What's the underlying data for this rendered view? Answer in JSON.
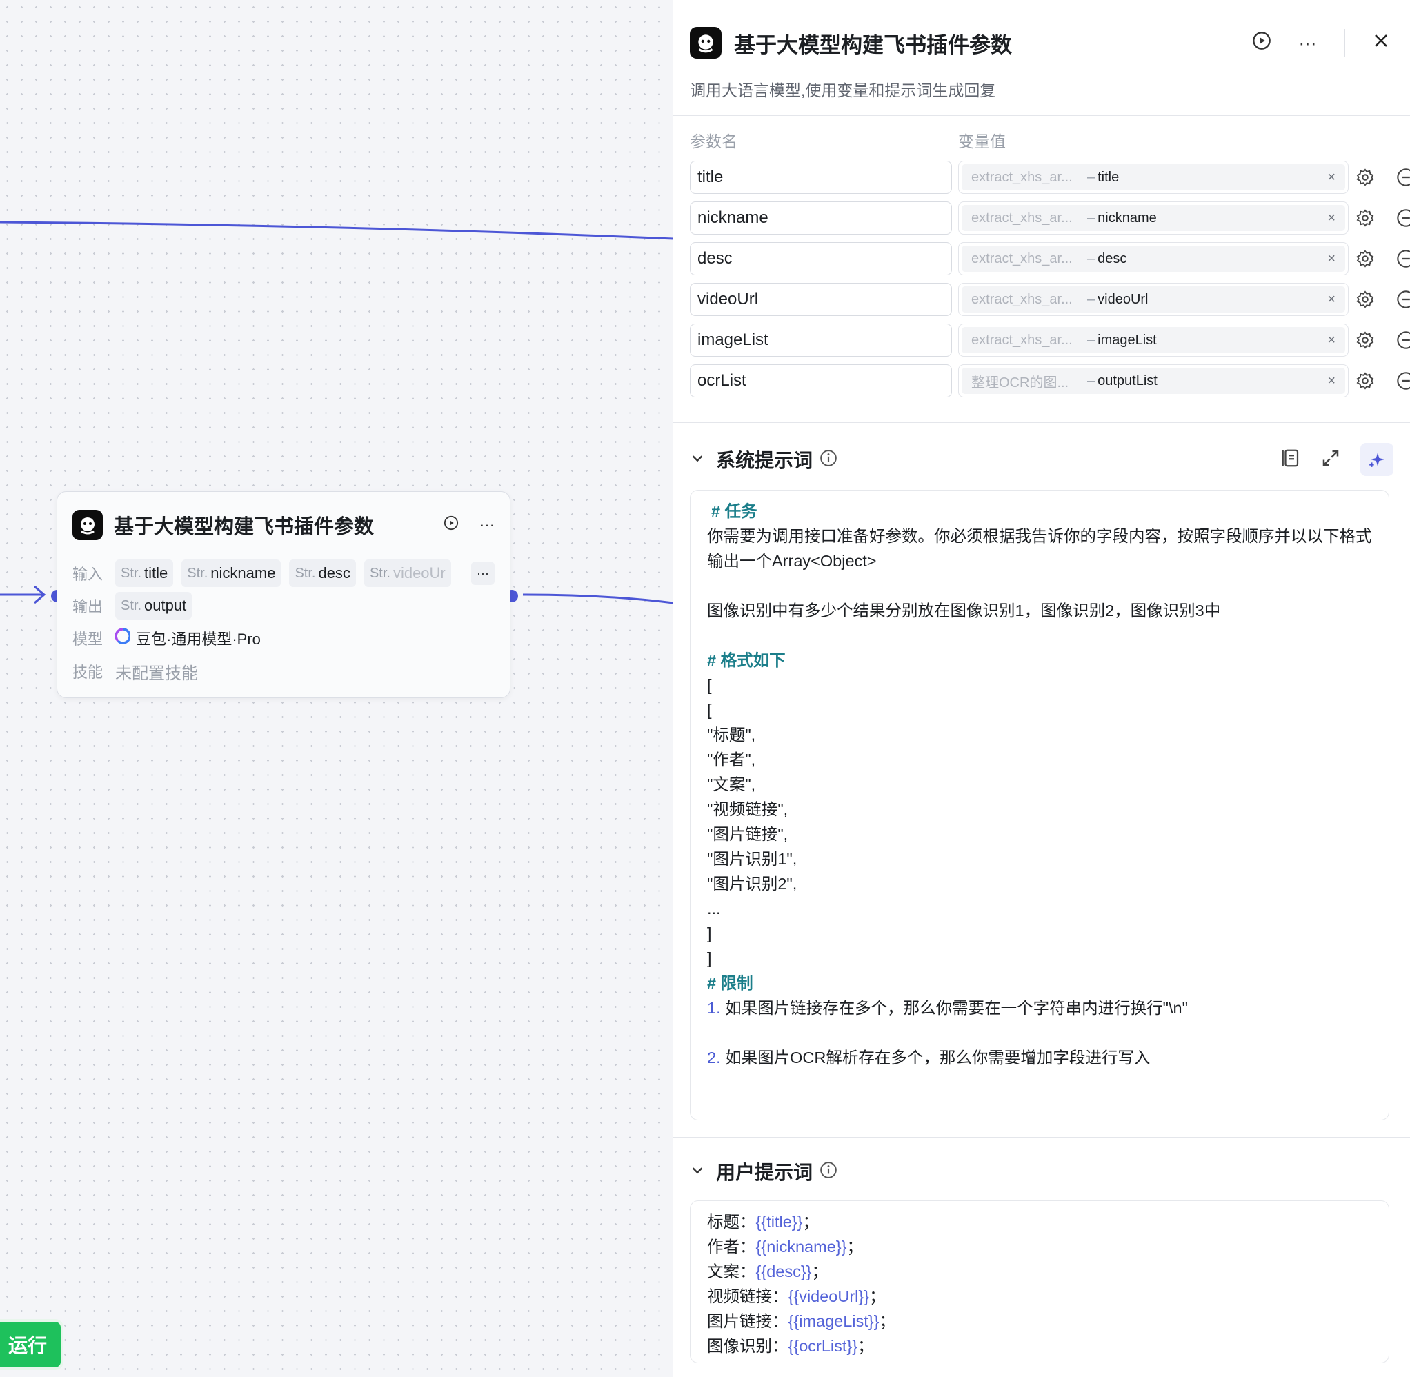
{
  "node": {
    "title": "基于大模型构建飞书插件参数",
    "input_label": "输入",
    "output_label": "输出",
    "model_label": "模型",
    "skill_label": "技能",
    "type_prefix": "Str.",
    "inputs": [
      "title",
      "nickname",
      "desc",
      "videoUr"
    ],
    "output": "output",
    "model_name": "豆包·通用模型·Pro",
    "skill_value": "未配置技能",
    "more": "···"
  },
  "run_button": "运行",
  "panel": {
    "title": "基于大模型构建飞书插件参数",
    "description": "调用大语言模型,使用变量和提示词生成回复",
    "col_param_name": "参数名",
    "col_value": "变量值",
    "params": [
      {
        "name": "title",
        "source": "extract_xhs_ar...",
        "field": "title"
      },
      {
        "name": "nickname",
        "source": "extract_xhs_ar...",
        "field": "nickname"
      },
      {
        "name": "desc",
        "source": "extract_xhs_ar...",
        "field": "desc"
      },
      {
        "name": "videoUrl",
        "source": "extract_xhs_ar...",
        "field": "videoUrl"
      },
      {
        "name": "imageList",
        "source": "extract_xhs_ar...",
        "field": "imageList"
      },
      {
        "name": "ocrList",
        "source": "整理OCR的图...",
        "field": "outputList"
      }
    ],
    "dash": "–",
    "clear": "×",
    "system_prompt_title": "系统提示词",
    "system_prompt": {
      "h_task": "# 任务",
      "task_text": "你需要为调用接口准备好参数。你必须根据我告诉你的字段内容，按照字段顺序并以以下格式输出一个Array<Object>",
      "ocr_text": "图像识别中有多少个结果分别放在图像识别1，图像识别2，图像识别3中",
      "h_format": "# 格式如下",
      "format_lines": [
        "[",
        "[",
        "\"标题\",",
        "\"作者\",",
        "\"文案\",",
        "\"视频链接\",",
        "\"图片链接\",",
        "\"图片识别1\",",
        "\"图片识别2\",",
        "...",
        "]",
        "]"
      ],
      "h_limit": "# 限制",
      "limit1_num": "1.",
      "limit1_text": "如果图片链接存在多个，那么你需要在一个字符串内进行换行\"\\n\"",
      "limit2_num": "2.",
      "limit2_text": "如果图片OCR解析存在多个，那么你需要增加字段进行写入"
    },
    "user_prompt_title": "用户提示词",
    "user_prompt": [
      {
        "label": "标题：",
        "var": "{{title}}",
        "end": "；"
      },
      {
        "label": "作者：",
        "var": "{{nickname}}",
        "end": "；"
      },
      {
        "label": "文案：",
        "var": "{{desc}}",
        "end": "；"
      },
      {
        "label": "视频链接：",
        "var": "{{videoUrl}}",
        "end": "；"
      },
      {
        "label": "图片链接：",
        "var": "{{imageList}}",
        "end": "；"
      },
      {
        "label": "图像识别：",
        "var": "{{ocrList}}",
        "end": "；"
      }
    ]
  },
  "colors": {
    "edge": "#4c56d6",
    "accent_teal": "#1b7e8a",
    "var_blue": "#5463d8",
    "run_green": "#1ec15c"
  },
  "icons": [
    "play-icon",
    "more-icon",
    "close-icon",
    "gear-icon",
    "minus-circle-icon",
    "chevron-down-icon",
    "info-icon",
    "library-icon",
    "expand-icon",
    "ai-sparkle-icon"
  ]
}
